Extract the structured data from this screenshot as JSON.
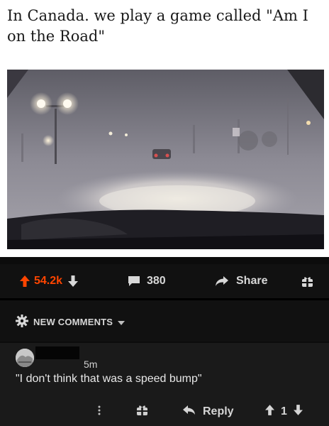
{
  "post": {
    "caption": "In  Canada. we play a game called \"Am I on the Road\""
  },
  "actions": {
    "score": "54.2k",
    "comments_count": "380",
    "share_label": "Share"
  },
  "comments_header": {
    "label": "NEW COMMENTS"
  },
  "comment": {
    "time": "5m",
    "body": "\"I don't think that was a speed bump\"",
    "reply_label": "Reply",
    "score": "1"
  },
  "colors": {
    "upvote": "#ff4500",
    "background": "#111111",
    "card": "#ffffff"
  },
  "icons": [
    "upvote-arrow-icon",
    "downvote-arrow-icon",
    "comment-bubble-icon",
    "share-arrow-icon",
    "gift-icon",
    "gear-icon",
    "chevron-down-icon",
    "more-vertical-icon",
    "reply-arrow-icon"
  ]
}
